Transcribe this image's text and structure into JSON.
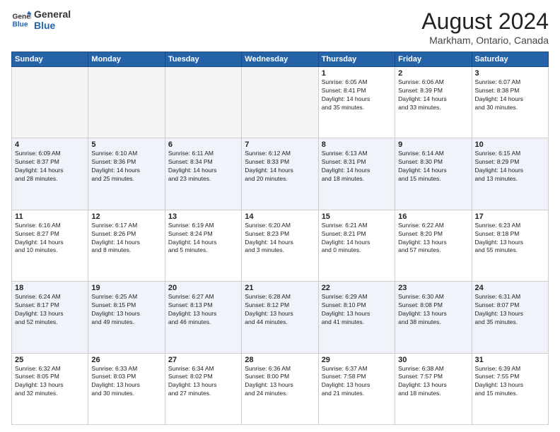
{
  "logo": {
    "line1": "General",
    "line2": "Blue"
  },
  "title": "August 2024",
  "subtitle": "Markham, Ontario, Canada",
  "days_header": [
    "Sunday",
    "Monday",
    "Tuesday",
    "Wednesday",
    "Thursday",
    "Friday",
    "Saturday"
  ],
  "weeks": [
    [
      {
        "day": "",
        "info": ""
      },
      {
        "day": "",
        "info": ""
      },
      {
        "day": "",
        "info": ""
      },
      {
        "day": "",
        "info": ""
      },
      {
        "day": "1",
        "info": "Sunrise: 6:05 AM\nSunset: 8:41 PM\nDaylight: 14 hours\nand 35 minutes."
      },
      {
        "day": "2",
        "info": "Sunrise: 6:06 AM\nSunset: 8:39 PM\nDaylight: 14 hours\nand 33 minutes."
      },
      {
        "day": "3",
        "info": "Sunrise: 6:07 AM\nSunset: 8:38 PM\nDaylight: 14 hours\nand 30 minutes."
      }
    ],
    [
      {
        "day": "4",
        "info": "Sunrise: 6:09 AM\nSunset: 8:37 PM\nDaylight: 14 hours\nand 28 minutes."
      },
      {
        "day": "5",
        "info": "Sunrise: 6:10 AM\nSunset: 8:36 PM\nDaylight: 14 hours\nand 25 minutes."
      },
      {
        "day": "6",
        "info": "Sunrise: 6:11 AM\nSunset: 8:34 PM\nDaylight: 14 hours\nand 23 minutes."
      },
      {
        "day": "7",
        "info": "Sunrise: 6:12 AM\nSunset: 8:33 PM\nDaylight: 14 hours\nand 20 minutes."
      },
      {
        "day": "8",
        "info": "Sunrise: 6:13 AM\nSunset: 8:31 PM\nDaylight: 14 hours\nand 18 minutes."
      },
      {
        "day": "9",
        "info": "Sunrise: 6:14 AM\nSunset: 8:30 PM\nDaylight: 14 hours\nand 15 minutes."
      },
      {
        "day": "10",
        "info": "Sunrise: 6:15 AM\nSunset: 8:29 PM\nDaylight: 14 hours\nand 13 minutes."
      }
    ],
    [
      {
        "day": "11",
        "info": "Sunrise: 6:16 AM\nSunset: 8:27 PM\nDaylight: 14 hours\nand 10 minutes."
      },
      {
        "day": "12",
        "info": "Sunrise: 6:17 AM\nSunset: 8:26 PM\nDaylight: 14 hours\nand 8 minutes."
      },
      {
        "day": "13",
        "info": "Sunrise: 6:19 AM\nSunset: 8:24 PM\nDaylight: 14 hours\nand 5 minutes."
      },
      {
        "day": "14",
        "info": "Sunrise: 6:20 AM\nSunset: 8:23 PM\nDaylight: 14 hours\nand 3 minutes."
      },
      {
        "day": "15",
        "info": "Sunrise: 6:21 AM\nSunset: 8:21 PM\nDaylight: 14 hours\nand 0 minutes."
      },
      {
        "day": "16",
        "info": "Sunrise: 6:22 AM\nSunset: 8:20 PM\nDaylight: 13 hours\nand 57 minutes."
      },
      {
        "day": "17",
        "info": "Sunrise: 6:23 AM\nSunset: 8:18 PM\nDaylight: 13 hours\nand 55 minutes."
      }
    ],
    [
      {
        "day": "18",
        "info": "Sunrise: 6:24 AM\nSunset: 8:17 PM\nDaylight: 13 hours\nand 52 minutes."
      },
      {
        "day": "19",
        "info": "Sunrise: 6:25 AM\nSunset: 8:15 PM\nDaylight: 13 hours\nand 49 minutes."
      },
      {
        "day": "20",
        "info": "Sunrise: 6:27 AM\nSunset: 8:13 PM\nDaylight: 13 hours\nand 46 minutes."
      },
      {
        "day": "21",
        "info": "Sunrise: 6:28 AM\nSunset: 8:12 PM\nDaylight: 13 hours\nand 44 minutes."
      },
      {
        "day": "22",
        "info": "Sunrise: 6:29 AM\nSunset: 8:10 PM\nDaylight: 13 hours\nand 41 minutes."
      },
      {
        "day": "23",
        "info": "Sunrise: 6:30 AM\nSunset: 8:08 PM\nDaylight: 13 hours\nand 38 minutes."
      },
      {
        "day": "24",
        "info": "Sunrise: 6:31 AM\nSunset: 8:07 PM\nDaylight: 13 hours\nand 35 minutes."
      }
    ],
    [
      {
        "day": "25",
        "info": "Sunrise: 6:32 AM\nSunset: 8:05 PM\nDaylight: 13 hours\nand 32 minutes."
      },
      {
        "day": "26",
        "info": "Sunrise: 6:33 AM\nSunset: 8:03 PM\nDaylight: 13 hours\nand 30 minutes."
      },
      {
        "day": "27",
        "info": "Sunrise: 6:34 AM\nSunset: 8:02 PM\nDaylight: 13 hours\nand 27 minutes."
      },
      {
        "day": "28",
        "info": "Sunrise: 6:36 AM\nSunset: 8:00 PM\nDaylight: 13 hours\nand 24 minutes."
      },
      {
        "day": "29",
        "info": "Sunrise: 6:37 AM\nSunset: 7:58 PM\nDaylight: 13 hours\nand 21 minutes."
      },
      {
        "day": "30",
        "info": "Sunrise: 6:38 AM\nSunset: 7:57 PM\nDaylight: 13 hours\nand 18 minutes."
      },
      {
        "day": "31",
        "info": "Sunrise: 6:39 AM\nSunset: 7:55 PM\nDaylight: 13 hours\nand 15 minutes."
      }
    ]
  ]
}
